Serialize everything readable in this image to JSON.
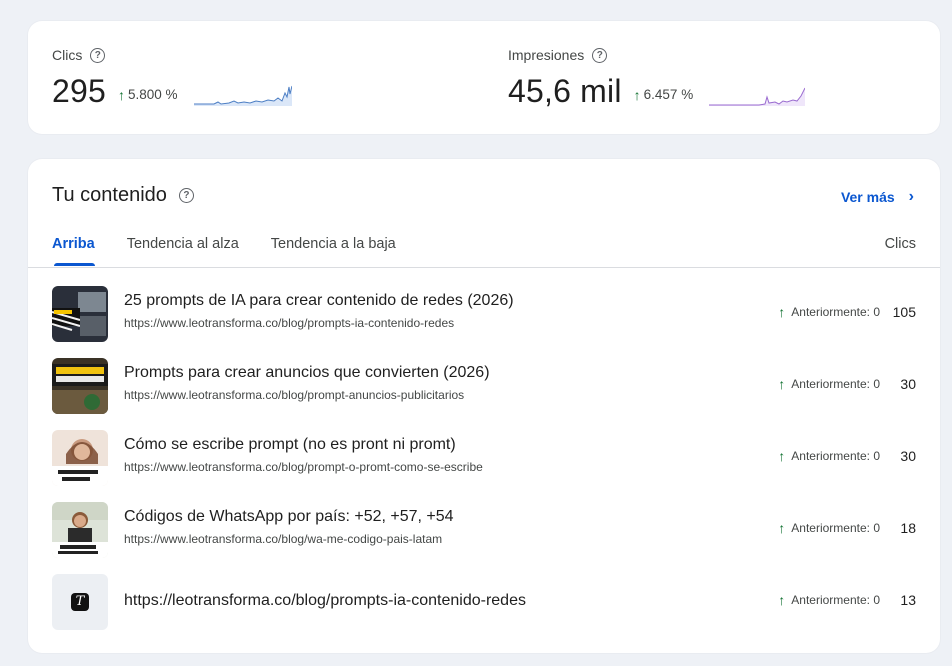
{
  "metrics": [
    {
      "label": "Clics",
      "value": "295",
      "change": "5.800 %",
      "color": "#4c7ec4"
    },
    {
      "label": "Impresiones",
      "value": "45,6 mil",
      "change": "6.457 %",
      "color": "#9a6bd0"
    }
  ],
  "content": {
    "title": "Tu contenido",
    "see_more": "Ver más",
    "tabs": [
      "Arriba",
      "Tendencia al alza",
      "Tendencia a la baja"
    ],
    "column_header": "Clics",
    "items": [
      {
        "title": "25 prompts de IA para crear contenido de redes (2026)",
        "url": "https://www.leotransforma.co/blog/prompts-ia-contenido-redes",
        "previous": "Anteriormente: 0",
        "clicks": "105"
      },
      {
        "title": "Prompts para crear anuncios que convierten (2026)",
        "url": "https://www.leotransforma.co/blog/prompt-anuncios-publicitarios",
        "previous": "Anteriormente: 0",
        "clicks": "30"
      },
      {
        "title": "Cómo se escribe prompt (no es pront ni promt)",
        "url": "https://www.leotransforma.co/blog/prompt-o-promt-como-se-escribe",
        "previous": "Anteriormente: 0",
        "clicks": "30"
      },
      {
        "title": "Códigos de WhatsApp por país: +52, +57, +54",
        "url": "https://www.leotransforma.co/blog/wa-me-codigo-pais-latam",
        "previous": "Anteriormente: 0",
        "clicks": "18"
      },
      {
        "title": "https://leotransforma.co/blog/prompts-ia-contenido-redes",
        "previous": "Anteriormente: 0",
        "clicks": "13",
        "logo_letter": "T"
      }
    ]
  },
  "icons": {
    "help": "help-circle-icon",
    "up": "arrow-up-icon",
    "chevron": "chevron-right-icon"
  },
  "colors": {
    "accent": "#0b57d0",
    "positive": "#137333"
  }
}
